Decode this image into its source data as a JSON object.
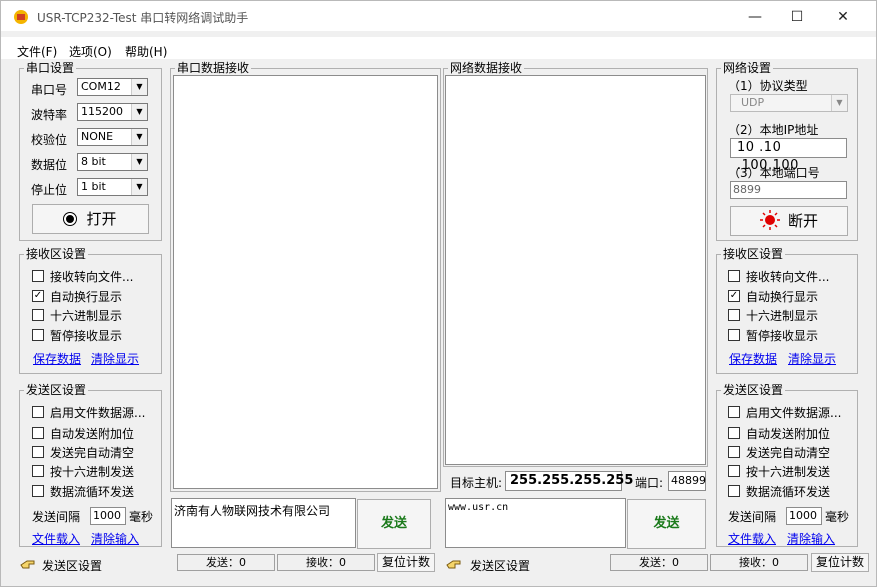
{
  "title": "USR-TCP232-Test 串口转网络调试助手",
  "window_controls": {
    "minimize": "—",
    "maximize": "☐",
    "close": "✕"
  },
  "menu": [
    "文件(F)",
    "选项(O)",
    "帮助(H)"
  ],
  "serial_settings": {
    "legend": "串口设置",
    "fields": [
      {
        "label": "串口号",
        "value": "COM12"
      },
      {
        "label": "波特率",
        "value": "115200"
      },
      {
        "label": "校验位",
        "value": "NONE"
      },
      {
        "label": "数据位",
        "value": "8 bit"
      },
      {
        "label": "停止位",
        "value": "1 bit"
      }
    ],
    "open_button": "打开"
  },
  "serial_rx_area": {
    "legend": "串口数据接收"
  },
  "net_rx_area": {
    "legend": "网络数据接收"
  },
  "net_settings": {
    "legend": "网络设置",
    "protocol_label": "（1）协议类型",
    "protocol_value": "UDP",
    "ip_label": "（2）本地IP地址",
    "ip_value": "10 .10 .100.100",
    "port_label": "（3）本地端口号",
    "port_value": "8899",
    "disconnect_button": "断开"
  },
  "left_rx_settings": {
    "legend": "接收区设置",
    "options": [
      {
        "label": "接收转向文件...",
        "checked": false
      },
      {
        "label": "自动换行显示",
        "checked": true
      },
      {
        "label": "十六进制显示",
        "checked": false
      },
      {
        "label": "暂停接收显示",
        "checked": false
      }
    ],
    "save_link": "保存数据",
    "clear_link": "清除显示"
  },
  "right_rx_settings": {
    "legend": "接收区设置",
    "options": [
      {
        "label": "接收转向文件...",
        "checked": false
      },
      {
        "label": "自动换行显示",
        "checked": true
      },
      {
        "label": "十六进制显示",
        "checked": false
      },
      {
        "label": "暂停接收显示",
        "checked": false
      }
    ],
    "save_link": "保存数据",
    "clear_link": "清除显示"
  },
  "left_tx_settings": {
    "legend": "发送区设置",
    "options": [
      {
        "label": "启用文件数据源...",
        "checked": false
      },
      {
        "label": "自动发送附加位",
        "checked": false
      },
      {
        "label": "发送完自动清空",
        "checked": false
      },
      {
        "label": "按十六进制发送",
        "checked": false
      },
      {
        "label": "数据流循环发送",
        "checked": false
      }
    ],
    "interval_label": "发送间隔",
    "interval_value": "1000",
    "interval_unit": "毫秒",
    "load_link": "文件载入",
    "clear_link": "清除输入"
  },
  "right_tx_settings": {
    "legend": "发送区设置",
    "options": [
      {
        "label": "启用文件数据源...",
        "checked": false
      },
      {
        "label": "自动发送附加位",
        "checked": false
      },
      {
        "label": "发送完自动清空",
        "checked": false
      },
      {
        "label": "按十六进制发送",
        "checked": false
      },
      {
        "label": "数据流循环发送",
        "checked": false
      }
    ],
    "interval_label": "发送间隔",
    "interval_value": "1000",
    "interval_unit": "毫秒",
    "load_link": "文件载入",
    "clear_link": "清除输入"
  },
  "target": {
    "host_label": "目标主机:",
    "host_value": "255.255.255.255",
    "port_label": "端口:",
    "port_value": "48899"
  },
  "serial_tx": {
    "text": "济南有人物联网技术有限公司",
    "send_button": "发送"
  },
  "net_tx": {
    "text": "www.usr.cn",
    "send_button": "发送"
  },
  "status_left": {
    "label": "发送区设置",
    "sent": "发送：0",
    "received": "接收：0",
    "reset": "复位计数"
  },
  "status_right": {
    "label": "发送区设置",
    "sent": "发送：0",
    "received": "接收：0",
    "reset": "复位计数"
  }
}
